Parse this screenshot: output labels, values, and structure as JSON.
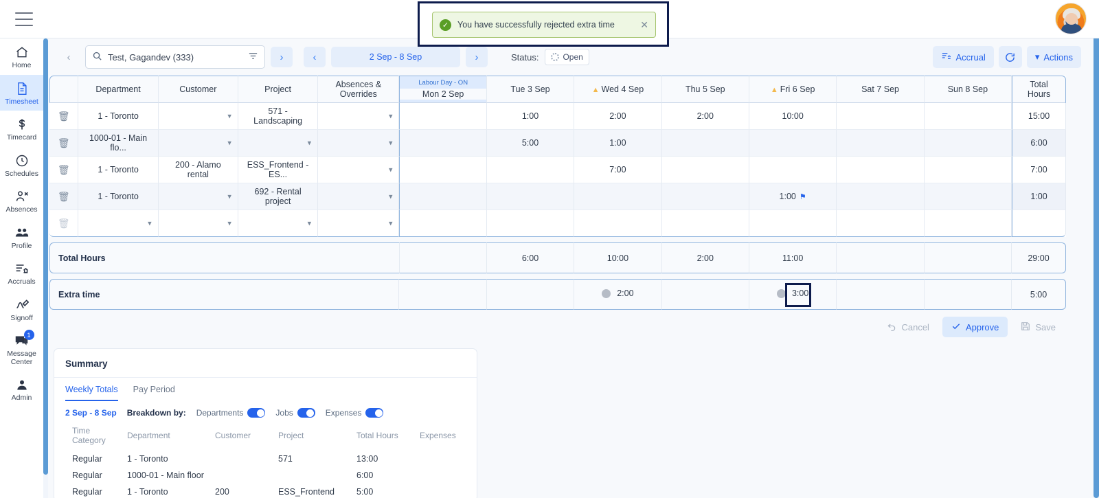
{
  "topbar": {
    "menu_icon": "hamburger-icon",
    "avatar_alt": "user-avatar"
  },
  "toast": {
    "message": "You have successfully rejected extra time",
    "check_icon": "check-circle-icon",
    "close_icon": "close-icon"
  },
  "sidebar": {
    "items": [
      {
        "label": "Home",
        "icon": "home-icon",
        "active": false
      },
      {
        "label": "Timesheet",
        "icon": "document-icon",
        "active": true
      },
      {
        "label": "Timecard",
        "icon": "dollar-icon",
        "active": false
      },
      {
        "label": "Schedules",
        "icon": "clock-icon",
        "active": false
      },
      {
        "label": "Absences",
        "icon": "person-remove-icon",
        "active": false
      },
      {
        "label": "Profile",
        "icon": "people-icon",
        "active": false
      },
      {
        "label": "Accruals",
        "icon": "list-bank-icon",
        "active": false
      },
      {
        "label": "Signoff",
        "icon": "signature-icon",
        "active": false
      },
      {
        "label": "Message Center",
        "icon": "chat-icon",
        "active": false,
        "badge": "1"
      },
      {
        "label": "Admin",
        "icon": "person-icon",
        "active": false
      }
    ]
  },
  "controls": {
    "prev_employee_icon": "chevron-left-icon",
    "next_employee_icon": "chevron-right-icon",
    "search": {
      "value": "Test, Gagandev (333)",
      "placeholder": "Search employee",
      "search_icon": "search-icon",
      "filter_icon": "filter-icon"
    },
    "prev_period_icon": "chevron-left-icon",
    "next_period_icon": "chevron-right-icon",
    "period": "2 Sep - 8 Sep",
    "status_label": "Status:",
    "status_value": "Open",
    "status_icon": "dotted-circle-icon",
    "accrual_label": "Accrual",
    "accrual_icon": "accrual-list-icon",
    "refresh_icon": "refresh-icon",
    "actions_label": "Actions",
    "actions_icon": "chevron-down-icon"
  },
  "timesheet": {
    "columns": [
      {
        "label": "",
        "key": "delete"
      },
      {
        "label": "Department",
        "key": "department"
      },
      {
        "label": "Customer",
        "key": "customer"
      },
      {
        "label": "Project",
        "key": "project"
      },
      {
        "label": "Absences & Overrides",
        "key": "absences"
      }
    ],
    "days": [
      {
        "label": "Mon 2 Sep",
        "holiday": "Labour Day - ON",
        "warning": false
      },
      {
        "label": "Tue 3 Sep",
        "holiday": "",
        "warning": false
      },
      {
        "label": "Wed 4 Sep",
        "holiday": "",
        "warning": true
      },
      {
        "label": "Thu 5 Sep",
        "holiday": "",
        "warning": false
      },
      {
        "label": "Fri 6 Sep",
        "holiday": "",
        "warning": true
      },
      {
        "label": "Sat 7 Sep",
        "holiday": "",
        "warning": false
      },
      {
        "label": "Sun 8 Sep",
        "holiday": "",
        "warning": false
      }
    ],
    "total_column": "Total Hours",
    "rows": [
      {
        "delete_icon": "trash-icon",
        "deletable": true,
        "department": "1 - Toronto",
        "department_chevron": false,
        "customer": "",
        "customer_chevron": true,
        "project": "571 - Landscaping",
        "project_chevron": false,
        "absences": "",
        "absences_chevron": true,
        "hours": [
          "",
          "1:00",
          "2:00",
          "2:00",
          "10:00",
          "",
          ""
        ],
        "flags": [
          "",
          "",
          "",
          "",
          "",
          "",
          ""
        ],
        "total": "15:00"
      },
      {
        "delete_icon": "trash-icon",
        "deletable": true,
        "department": "1000-01 - Main flo...",
        "department_chevron": false,
        "customer": "",
        "customer_chevron": true,
        "project": "",
        "project_chevron": true,
        "absences": "",
        "absences_chevron": true,
        "hours": [
          "",
          "5:00",
          "1:00",
          "",
          "",
          "",
          ""
        ],
        "flags": [
          "",
          "",
          "",
          "",
          "",
          "",
          ""
        ],
        "total": "6:00"
      },
      {
        "delete_icon": "trash-icon",
        "deletable": true,
        "department": "1 - Toronto",
        "department_chevron": false,
        "customer": "200 - Alamo rental",
        "customer_chevron": false,
        "project": "ESS_Frontend - ES...",
        "project_chevron": false,
        "absences": "",
        "absences_chevron": true,
        "hours": [
          "",
          "",
          "7:00",
          "",
          "",
          "",
          ""
        ],
        "flags": [
          "",
          "",
          "",
          "",
          "",
          "",
          ""
        ],
        "total": "7:00"
      },
      {
        "delete_icon": "trash-icon",
        "deletable": true,
        "department": "1 - Toronto",
        "department_chevron": false,
        "customer": "",
        "customer_chevron": true,
        "project": "692 - Rental project",
        "project_chevron": false,
        "absences": "",
        "absences_chevron": true,
        "hours": [
          "",
          "",
          "",
          "",
          "1:00",
          "",
          ""
        ],
        "flags": [
          "",
          "",
          "",
          "",
          "flag-icon",
          "",
          ""
        ],
        "total": "1:00"
      },
      {
        "delete_icon": "trash-icon",
        "deletable": false,
        "department": "",
        "department_chevron": true,
        "customer": "",
        "customer_chevron": true,
        "project": "",
        "project_chevron": true,
        "absences": "",
        "absences_chevron": true,
        "hours": [
          "",
          "",
          "",
          "",
          "",
          "",
          ""
        ],
        "flags": [
          "",
          "",
          "",
          "",
          "",
          "",
          ""
        ],
        "total": ""
      }
    ],
    "totals_row": {
      "label": "Total Hours",
      "values": [
        "",
        "6:00",
        "10:00",
        "2:00",
        "11:00",
        "",
        ""
      ],
      "total": "29:00"
    },
    "extra_time_row": {
      "label": "Extra time",
      "values": [
        "",
        "",
        "2:00",
        "",
        "3:00",
        "",
        ""
      ],
      "dots": [
        "",
        "",
        "gray-dot",
        "",
        "gray-dot",
        "",
        ""
      ],
      "highlight_index": 4,
      "total": "5:00"
    }
  },
  "action_buttons": {
    "cancel": {
      "label": "Cancel",
      "icon": "undo-icon",
      "enabled": false
    },
    "approve": {
      "label": "Approve",
      "icon": "check-icon",
      "enabled": true
    },
    "save": {
      "label": "Save",
      "icon": "save-icon",
      "enabled": false
    }
  },
  "summary": {
    "title": "Summary",
    "tabs": [
      {
        "label": "Weekly Totals",
        "active": true
      },
      {
        "label": "Pay Period",
        "active": false
      }
    ],
    "period": "2 Sep - 8 Sep",
    "breakdown_label": "Breakdown by:",
    "toggles": [
      {
        "label": "Departments",
        "on": true
      },
      {
        "label": "Jobs",
        "on": true
      },
      {
        "label": "Expenses",
        "on": true
      }
    ],
    "columns": [
      "Time Category",
      "Department",
      "Customer",
      "Project",
      "Total Hours",
      "Expenses"
    ],
    "rows": [
      {
        "category": "Regular",
        "department": "1 - Toronto",
        "customer": "",
        "project": "571",
        "total_hours": "13:00",
        "expenses": ""
      },
      {
        "category": "Regular",
        "department": "1000-01 - Main floor",
        "customer": "",
        "project": "",
        "total_hours": "6:00",
        "expenses": ""
      },
      {
        "category": "Regular",
        "department": "1 - Toronto",
        "customer": "200",
        "project": "ESS_Frontend",
        "total_hours": "5:00",
        "expenses": ""
      }
    ]
  },
  "colors": {
    "accent": "#2563eb",
    "accent_soft": "#e5eefb",
    "success": "#5a9e25",
    "toast_bg": "#eef7e3",
    "highlight": "#0d1b4c",
    "warning": "#f3b94d",
    "scrollbar": "#5b9bd5"
  }
}
